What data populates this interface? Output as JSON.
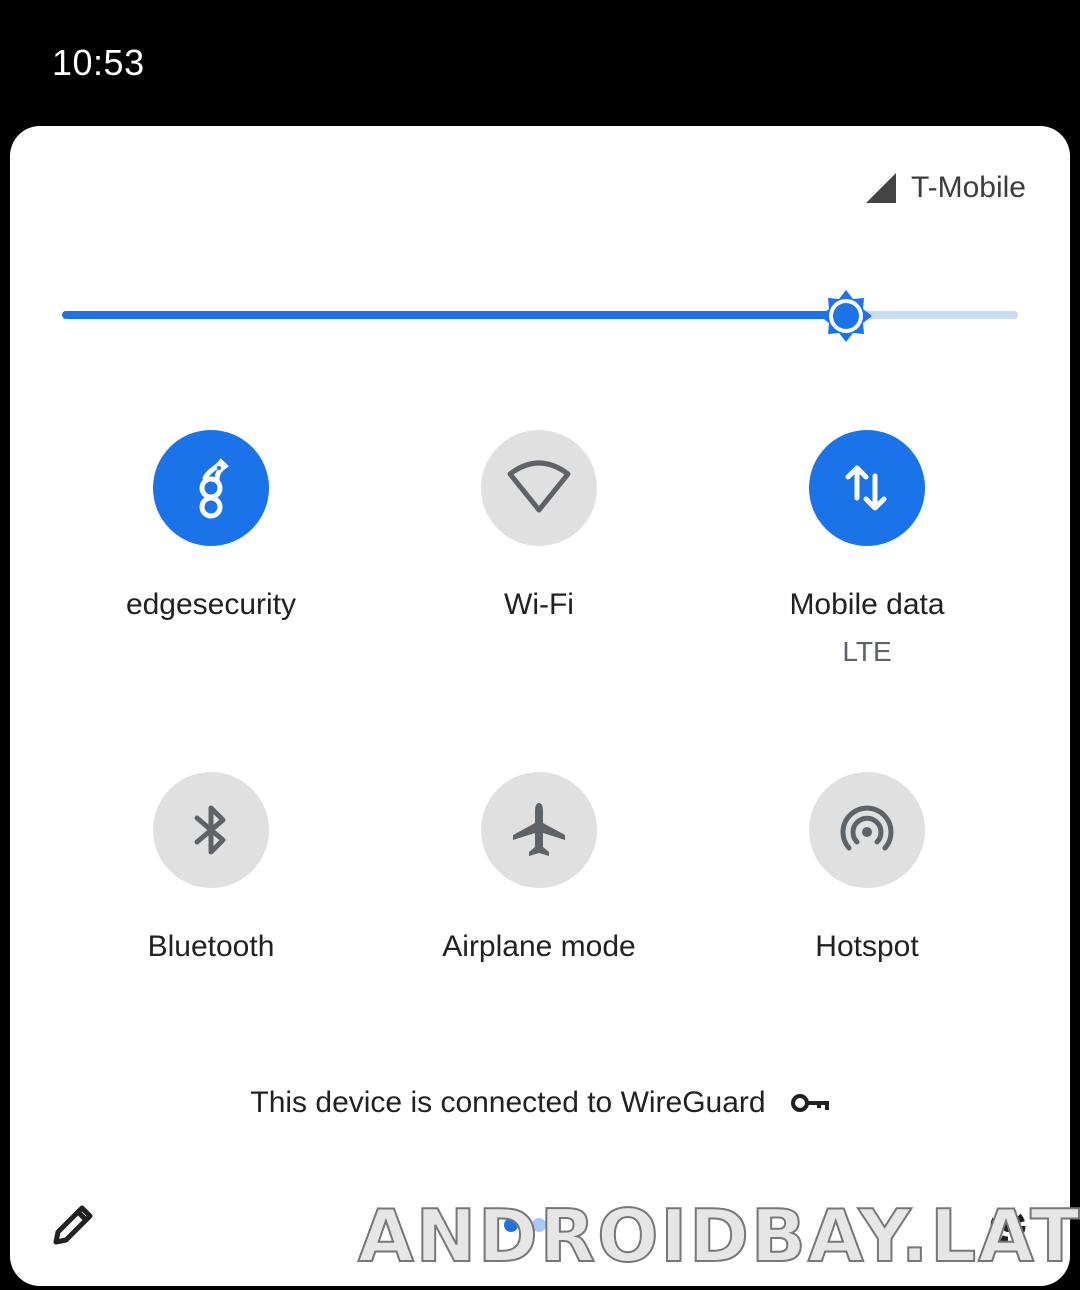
{
  "status_bar": {
    "time": "10:53"
  },
  "panel": {
    "carrier": {
      "name": "T-Mobile",
      "icon": "signal-icon"
    },
    "brightness": {
      "level": 0.82,
      "icon": "brightness-icon"
    },
    "tiles": [
      {
        "label": "edgesecurity",
        "sublabel": "",
        "state": "on",
        "icon": "wireguard-dragon-icon"
      },
      {
        "label": "Wi-Fi",
        "sublabel": "",
        "state": "off",
        "icon": "wifi-icon"
      },
      {
        "label": "Mobile data",
        "sublabel": "LTE",
        "state": "on",
        "icon": "data-arrows-icon"
      },
      {
        "label": "Bluetooth",
        "sublabel": "",
        "state": "off",
        "icon": "bluetooth-icon"
      },
      {
        "label": "Airplane mode",
        "sublabel": "",
        "state": "off",
        "icon": "airplane-icon"
      },
      {
        "label": "Hotspot",
        "sublabel": "",
        "state": "off",
        "icon": "hotspot-icon"
      }
    ],
    "vpn_notice": {
      "text": "This device is connected to WireGuard",
      "icon": "key-icon"
    },
    "footer": {
      "edit_icon": "pencil-icon",
      "settings_icon": "gear-icon",
      "page_dots": [
        {
          "active": true
        },
        {
          "active": false
        }
      ]
    }
  },
  "watermark": "ANDROIDBAY.LAT",
  "colors": {
    "accent": "#1a73e8",
    "tile_off": "#e0e0e0",
    "panel": "#ffffff",
    "background": "#000000"
  }
}
